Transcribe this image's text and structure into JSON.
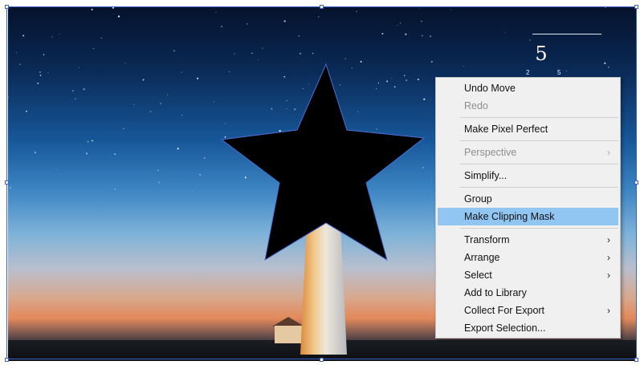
{
  "artboard": {
    "number": "5",
    "tick_labels": [
      "2",
      "5"
    ]
  },
  "selection": {
    "accent_color": "#3a63c9",
    "shape_icon": "star-icon"
  },
  "context_menu": {
    "hover_color": "#92c6f2",
    "items": [
      {
        "label": "Undo Move",
        "enabled": true,
        "submenu": false
      },
      {
        "label": "Redo",
        "enabled": false,
        "submenu": false
      },
      {
        "label": "Make Pixel Perfect",
        "enabled": true,
        "submenu": false
      },
      {
        "label": "Perspective",
        "enabled": false,
        "submenu": true
      },
      {
        "label": "Simplify...",
        "enabled": true,
        "submenu": false
      },
      {
        "label": "Group",
        "enabled": true,
        "submenu": false
      },
      {
        "label": "Make Clipping Mask",
        "enabled": true,
        "submenu": false,
        "highlighted": true
      },
      {
        "label": "Transform",
        "enabled": true,
        "submenu": true
      },
      {
        "label": "Arrange",
        "enabled": true,
        "submenu": true
      },
      {
        "label": "Select",
        "enabled": true,
        "submenu": true
      },
      {
        "label": "Add to Library",
        "enabled": true,
        "submenu": false
      },
      {
        "label": "Collect For Export",
        "enabled": true,
        "submenu": true
      },
      {
        "label": "Export Selection...",
        "enabled": true,
        "submenu": false
      }
    ],
    "submenu_glyph": "›"
  }
}
